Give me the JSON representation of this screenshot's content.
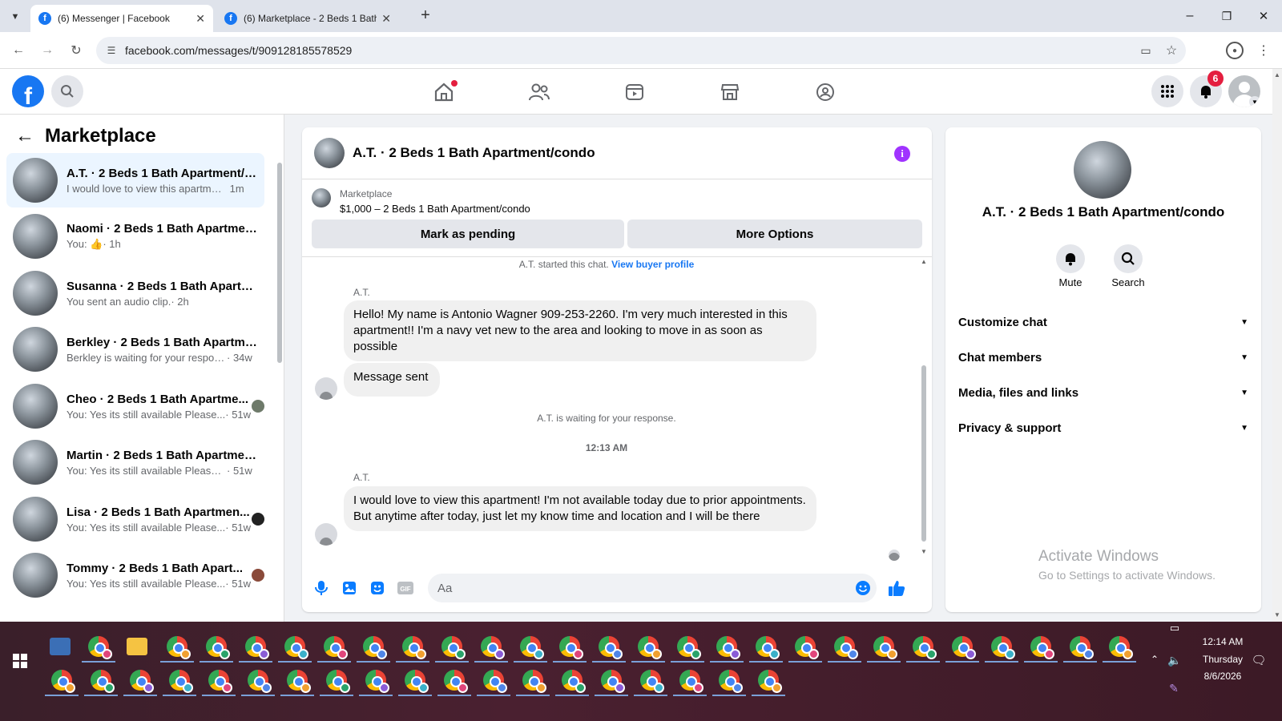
{
  "browser": {
    "tabs": [
      {
        "title": "(6) Messenger | Facebook"
      },
      {
        "title": "(6) Marketplace - 2 Beds 1 Bath"
      }
    ],
    "url": "facebook.com/messages/t/909128185578529",
    "controls": {
      "minimize": "–",
      "maximize": "❐",
      "close": "✕",
      "new_tab": "+"
    }
  },
  "fb_header": {
    "notification_count": "6",
    "nav_icons": [
      "home-icon",
      "friends-icon",
      "video-icon",
      "marketplace-icon",
      "groups-icon"
    ]
  },
  "left_panel": {
    "title": "Marketplace",
    "conversations": [
      {
        "name": "A.T. · 2 Beds 1 Bath Apartment/c...",
        "preview": "I would love to view this apartmen...",
        "time": "1m",
        "selected": true
      },
      {
        "name": "Naomi · 2 Beds 1 Bath Apartmen...",
        "preview": "You: 👍",
        "time": "· 1h"
      },
      {
        "name": "Susanna · 2 Beds 1 Bath Apartm...",
        "preview": "You sent an audio clip.",
        "time": "· 2h"
      },
      {
        "name": "Berkley · 2 Beds 1 Bath Apartme...",
        "preview": "Berkley is waiting for your respon...",
        "time": "· 34w"
      },
      {
        "name": "Cheo · 2 Beds 1 Bath Apartme...",
        "preview": "You: Yes its still available Please...",
        "time": "· 51w"
      },
      {
        "name": "Martin · 2 Beds 1 Bath Apartmen...",
        "preview": "You: Yes its still available Please se...",
        "time": "· 51w"
      },
      {
        "name": "Lisa · 2 Beds 1 Bath Apartmen...",
        "preview": "You: Yes its still available Please...",
        "time": "· 51w"
      },
      {
        "name": "Tommy · 2 Beds 1 Bath Apart...",
        "preview": "You: Yes its still available Please...",
        "time": "· 51w"
      }
    ]
  },
  "chat": {
    "title": "A.T. · 2 Beds 1 Bath Apartment/condo",
    "listing": {
      "source": "Marketplace",
      "summary": "$1,000 – 2 Beds 1 Bath Apartment/condo"
    },
    "buttons": {
      "pending": "Mark as pending",
      "more": "More Options"
    },
    "started_text": "A.T. started this chat.",
    "view_profile": "View buyer profile",
    "sender": "A.T.",
    "messages": [
      "Hello! My name is Antonio Wagner 909-253-2260. I'm very much interested in this apartment!! I'm a navy vet new to the area and looking to move in as soon as possible",
      "Message sent",
      "I would love to view this apartment! I'm not available today due to prior appointments. But anytime after today, just let my know time and location and I will be there"
    ],
    "waiting_text": "A.T. is waiting for your response.",
    "timestamp": "12:13 AM",
    "composer_placeholder": "Aa"
  },
  "right_panel": {
    "name": "A.T. · 2 Beds 1 Bath Apartment/condo",
    "actions": [
      {
        "label": "Mute"
      },
      {
        "label": "Search"
      }
    ],
    "sections": [
      "Customize chat",
      "Chat members",
      "Media, files and links",
      "Privacy & support"
    ],
    "watermark": {
      "line1": "Activate Windows",
      "line2": "Go to Settings to activate Windows."
    }
  },
  "taskbar": {
    "time": "12:14 AM",
    "day": "Thursday",
    "date": "8/6/2026"
  },
  "colors": {
    "accent": "#1877f2",
    "messenger_blue": "#0a7cff",
    "info_purple": "#a033ff"
  }
}
